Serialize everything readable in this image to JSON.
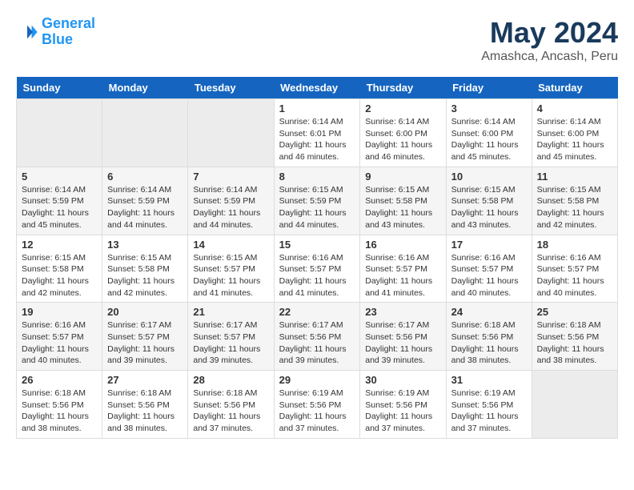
{
  "header": {
    "logo_line1": "General",
    "logo_line2": "Blue",
    "title": "May 2024",
    "subtitle": "Amashca, Ancash, Peru"
  },
  "days_of_week": [
    "Sunday",
    "Monday",
    "Tuesday",
    "Wednesday",
    "Thursday",
    "Friday",
    "Saturday"
  ],
  "weeks": [
    [
      {
        "day": "",
        "info": ""
      },
      {
        "day": "",
        "info": ""
      },
      {
        "day": "",
        "info": ""
      },
      {
        "day": "1",
        "info": "Sunrise: 6:14 AM\nSunset: 6:01 PM\nDaylight: 11 hours\nand 46 minutes."
      },
      {
        "day": "2",
        "info": "Sunrise: 6:14 AM\nSunset: 6:00 PM\nDaylight: 11 hours\nand 46 minutes."
      },
      {
        "day": "3",
        "info": "Sunrise: 6:14 AM\nSunset: 6:00 PM\nDaylight: 11 hours\nand 45 minutes."
      },
      {
        "day": "4",
        "info": "Sunrise: 6:14 AM\nSunset: 6:00 PM\nDaylight: 11 hours\nand 45 minutes."
      }
    ],
    [
      {
        "day": "5",
        "info": "Sunrise: 6:14 AM\nSunset: 5:59 PM\nDaylight: 11 hours\nand 45 minutes."
      },
      {
        "day": "6",
        "info": "Sunrise: 6:14 AM\nSunset: 5:59 PM\nDaylight: 11 hours\nand 44 minutes."
      },
      {
        "day": "7",
        "info": "Sunrise: 6:14 AM\nSunset: 5:59 PM\nDaylight: 11 hours\nand 44 minutes."
      },
      {
        "day": "8",
        "info": "Sunrise: 6:15 AM\nSunset: 5:59 PM\nDaylight: 11 hours\nand 44 minutes."
      },
      {
        "day": "9",
        "info": "Sunrise: 6:15 AM\nSunset: 5:58 PM\nDaylight: 11 hours\nand 43 minutes."
      },
      {
        "day": "10",
        "info": "Sunrise: 6:15 AM\nSunset: 5:58 PM\nDaylight: 11 hours\nand 43 minutes."
      },
      {
        "day": "11",
        "info": "Sunrise: 6:15 AM\nSunset: 5:58 PM\nDaylight: 11 hours\nand 42 minutes."
      }
    ],
    [
      {
        "day": "12",
        "info": "Sunrise: 6:15 AM\nSunset: 5:58 PM\nDaylight: 11 hours\nand 42 minutes."
      },
      {
        "day": "13",
        "info": "Sunrise: 6:15 AM\nSunset: 5:58 PM\nDaylight: 11 hours\nand 42 minutes."
      },
      {
        "day": "14",
        "info": "Sunrise: 6:15 AM\nSunset: 5:57 PM\nDaylight: 11 hours\nand 41 minutes."
      },
      {
        "day": "15",
        "info": "Sunrise: 6:16 AM\nSunset: 5:57 PM\nDaylight: 11 hours\nand 41 minutes."
      },
      {
        "day": "16",
        "info": "Sunrise: 6:16 AM\nSunset: 5:57 PM\nDaylight: 11 hours\nand 41 minutes."
      },
      {
        "day": "17",
        "info": "Sunrise: 6:16 AM\nSunset: 5:57 PM\nDaylight: 11 hours\nand 40 minutes."
      },
      {
        "day": "18",
        "info": "Sunrise: 6:16 AM\nSunset: 5:57 PM\nDaylight: 11 hours\nand 40 minutes."
      }
    ],
    [
      {
        "day": "19",
        "info": "Sunrise: 6:16 AM\nSunset: 5:57 PM\nDaylight: 11 hours\nand 40 minutes."
      },
      {
        "day": "20",
        "info": "Sunrise: 6:17 AM\nSunset: 5:57 PM\nDaylight: 11 hours\nand 39 minutes."
      },
      {
        "day": "21",
        "info": "Sunrise: 6:17 AM\nSunset: 5:57 PM\nDaylight: 11 hours\nand 39 minutes."
      },
      {
        "day": "22",
        "info": "Sunrise: 6:17 AM\nSunset: 5:56 PM\nDaylight: 11 hours\nand 39 minutes."
      },
      {
        "day": "23",
        "info": "Sunrise: 6:17 AM\nSunset: 5:56 PM\nDaylight: 11 hours\nand 39 minutes."
      },
      {
        "day": "24",
        "info": "Sunrise: 6:18 AM\nSunset: 5:56 PM\nDaylight: 11 hours\nand 38 minutes."
      },
      {
        "day": "25",
        "info": "Sunrise: 6:18 AM\nSunset: 5:56 PM\nDaylight: 11 hours\nand 38 minutes."
      }
    ],
    [
      {
        "day": "26",
        "info": "Sunrise: 6:18 AM\nSunset: 5:56 PM\nDaylight: 11 hours\nand 38 minutes."
      },
      {
        "day": "27",
        "info": "Sunrise: 6:18 AM\nSunset: 5:56 PM\nDaylight: 11 hours\nand 38 minutes."
      },
      {
        "day": "28",
        "info": "Sunrise: 6:18 AM\nSunset: 5:56 PM\nDaylight: 11 hours\nand 37 minutes."
      },
      {
        "day": "29",
        "info": "Sunrise: 6:19 AM\nSunset: 5:56 PM\nDaylight: 11 hours\nand 37 minutes."
      },
      {
        "day": "30",
        "info": "Sunrise: 6:19 AM\nSunset: 5:56 PM\nDaylight: 11 hours\nand 37 minutes."
      },
      {
        "day": "31",
        "info": "Sunrise: 6:19 AM\nSunset: 5:56 PM\nDaylight: 11 hours\nand 37 minutes."
      },
      {
        "day": "",
        "info": ""
      }
    ]
  ]
}
